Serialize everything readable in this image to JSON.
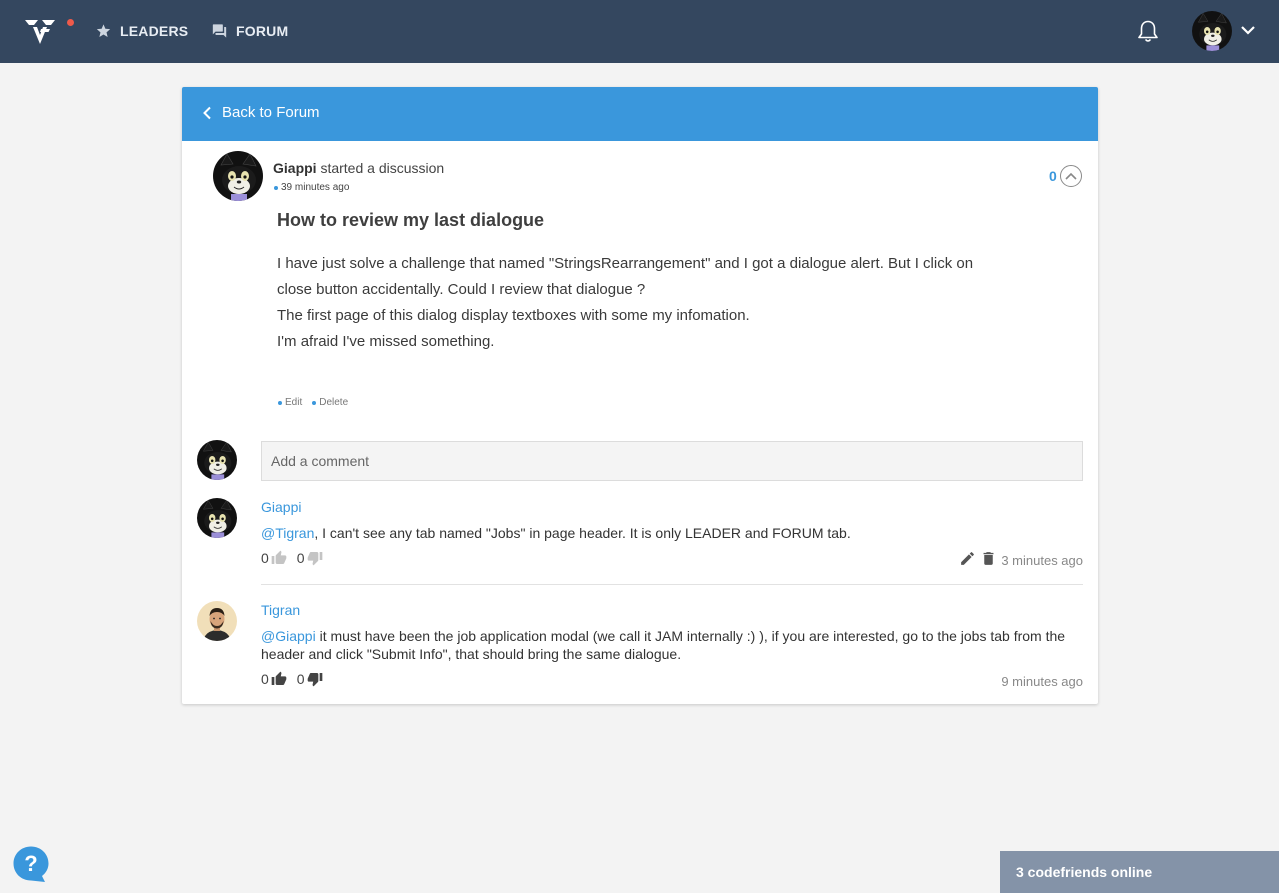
{
  "nav": {
    "leaders_label": "LEADERS",
    "forum_label": "FORUM",
    "notification_dot_color": "#ef5a4a"
  },
  "thread": {
    "back_label": "Back to Forum",
    "author": "Giappi",
    "action_text": "started a discussion",
    "time": "39 minutes ago",
    "votes": "0",
    "title": "How to review my last dialogue",
    "body": [
      "I have just solve a challenge that named \"StringsRearrangement\" and I got a dialogue alert. But I click on",
      "close button accidentally. Could I review that dialogue ?",
      "The first page of this dialog display textboxes with some my infomation.",
      "I'm afraid I've missed something."
    ],
    "edit_label": "Edit",
    "delete_label": "Delete"
  },
  "comment_box": {
    "placeholder": "Add a comment"
  },
  "comments": [
    {
      "author": "Giappi",
      "mention": "@Tigran",
      "text": ", I can't see any tab named \"Jobs\" in page header. It is only LEADER and FORUM tab.",
      "likes": "0",
      "dislikes": "0",
      "time": "3 minutes ago"
    },
    {
      "author": "Tigran",
      "mention": "@Giappi",
      "text": " it must have been the job application modal (we call it JAM internally :) ), if you are interested, go to the jobs tab from the header and click \"Submit Info\", that should bring the same dialogue.",
      "likes": "0",
      "dislikes": "0",
      "time": "9 minutes ago"
    }
  ],
  "footer": {
    "online_label": "3 codefriends online"
  },
  "colors": {
    "topbar": "#34475f",
    "accent": "#3a97dc",
    "online_bar": "#8493a8"
  }
}
